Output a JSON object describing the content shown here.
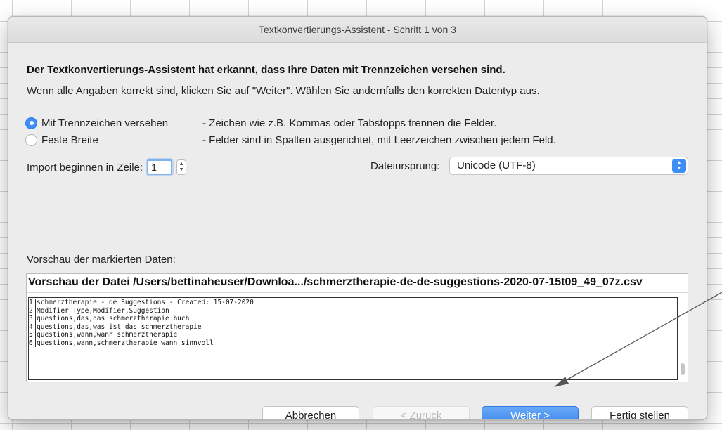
{
  "window": {
    "title": "Textkonvertierungs-Assistent - Schritt 1 von 3"
  },
  "intro": {
    "heading": "Der Textkonvertierungs-Assistent hat erkannt, dass Ihre Daten mit Trennzeichen versehen sind.",
    "subtext": "Wenn alle Angaben korrekt sind, klicken Sie auf \"Weiter\". Wählen Sie andernfalls den korrekten Datentyp aus."
  },
  "options": [
    {
      "label": "Mit Trennzeichen versehen",
      "description": "- Zeichen wie z.B. Kommas oder Tabstopps trennen die Felder.",
      "selected": true
    },
    {
      "label": "Feste Breite",
      "description": "- Felder sind in Spalten ausgerichtet, mit Leerzeichen zwischen jedem Feld.",
      "selected": false
    }
  ],
  "start_row": {
    "label": "Import beginnen in Zeile:",
    "value": "1"
  },
  "file_origin": {
    "label": "Dateiursprung:",
    "selected": "Unicode (UTF-8)"
  },
  "preview": {
    "section_label": "Vorschau der markierten Daten:",
    "file_title": "Vorschau der Datei /Users/bettinaheuser/Downloa.../schmerztherapie-de-de-suggestions-2020-07-15t09_49_07z.csv",
    "lines": [
      {
        "num": "1",
        "text": "schmerztherapie - de Suggestions - Created: 15-07-2020"
      },
      {
        "num": "2",
        "text": "Modifier Type,Modifier,Suggestion"
      },
      {
        "num": "3",
        "text": "questions,das,das schmerztherapie buch"
      },
      {
        "num": "4",
        "text": "questions,das,was ist das schmerztherapie"
      },
      {
        "num": "5",
        "text": "questions,wann,wann schmerztherapie"
      },
      {
        "num": "6",
        "text": "questions,wann,schmerztherapie wann sinnvoll"
      }
    ]
  },
  "buttons": {
    "cancel": "Abbrechen",
    "back": "< Zurück",
    "next": "Weiter >",
    "finish": "Fertig stellen"
  },
  "colors": {
    "accent": "#3d8ff5",
    "annotation_arrow": "#555555"
  }
}
